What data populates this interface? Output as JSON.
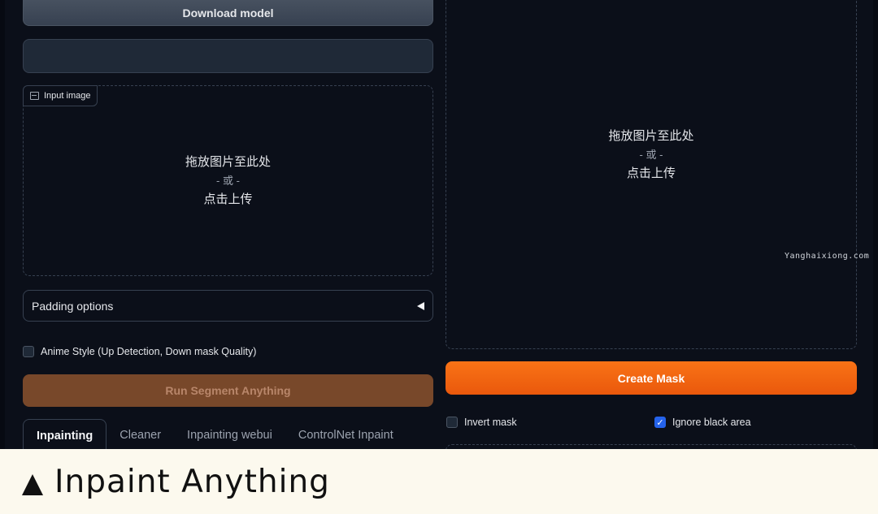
{
  "left_panel": {
    "download_button": "Download model",
    "input_image_label": "Input image",
    "drop_zone": {
      "line1": "拖放图片至此处",
      "line2": "- 或 -",
      "line3": "点击上传"
    },
    "padding_options": "Padding options",
    "anime_style": {
      "label": "Anime Style (Up Detection, Down mask Quality)",
      "checked": false
    },
    "run_button": "Run Segment Anything",
    "tabs": [
      "Inpainting",
      "Cleaner",
      "Inpainting webui",
      "ControlNet Inpaint"
    ],
    "active_tab": "Inpainting"
  },
  "right_panel": {
    "drop_zone": {
      "line1": "拖放图片至此处",
      "line2": "- 或 -",
      "line3": "点击上传"
    },
    "create_mask_button": "Create Mask",
    "invert_mask": {
      "label": "Invert mask",
      "checked": false
    },
    "ignore_black_area": {
      "label": "Ignore black area",
      "checked": true
    }
  },
  "watermark": "Yanghaixiong.com",
  "caption": "Inpaint Anything",
  "colors": {
    "accent": "#f97316",
    "run_button": "#78482a",
    "background": "#0b0f19",
    "caption_bg": "#fcf9ee"
  }
}
